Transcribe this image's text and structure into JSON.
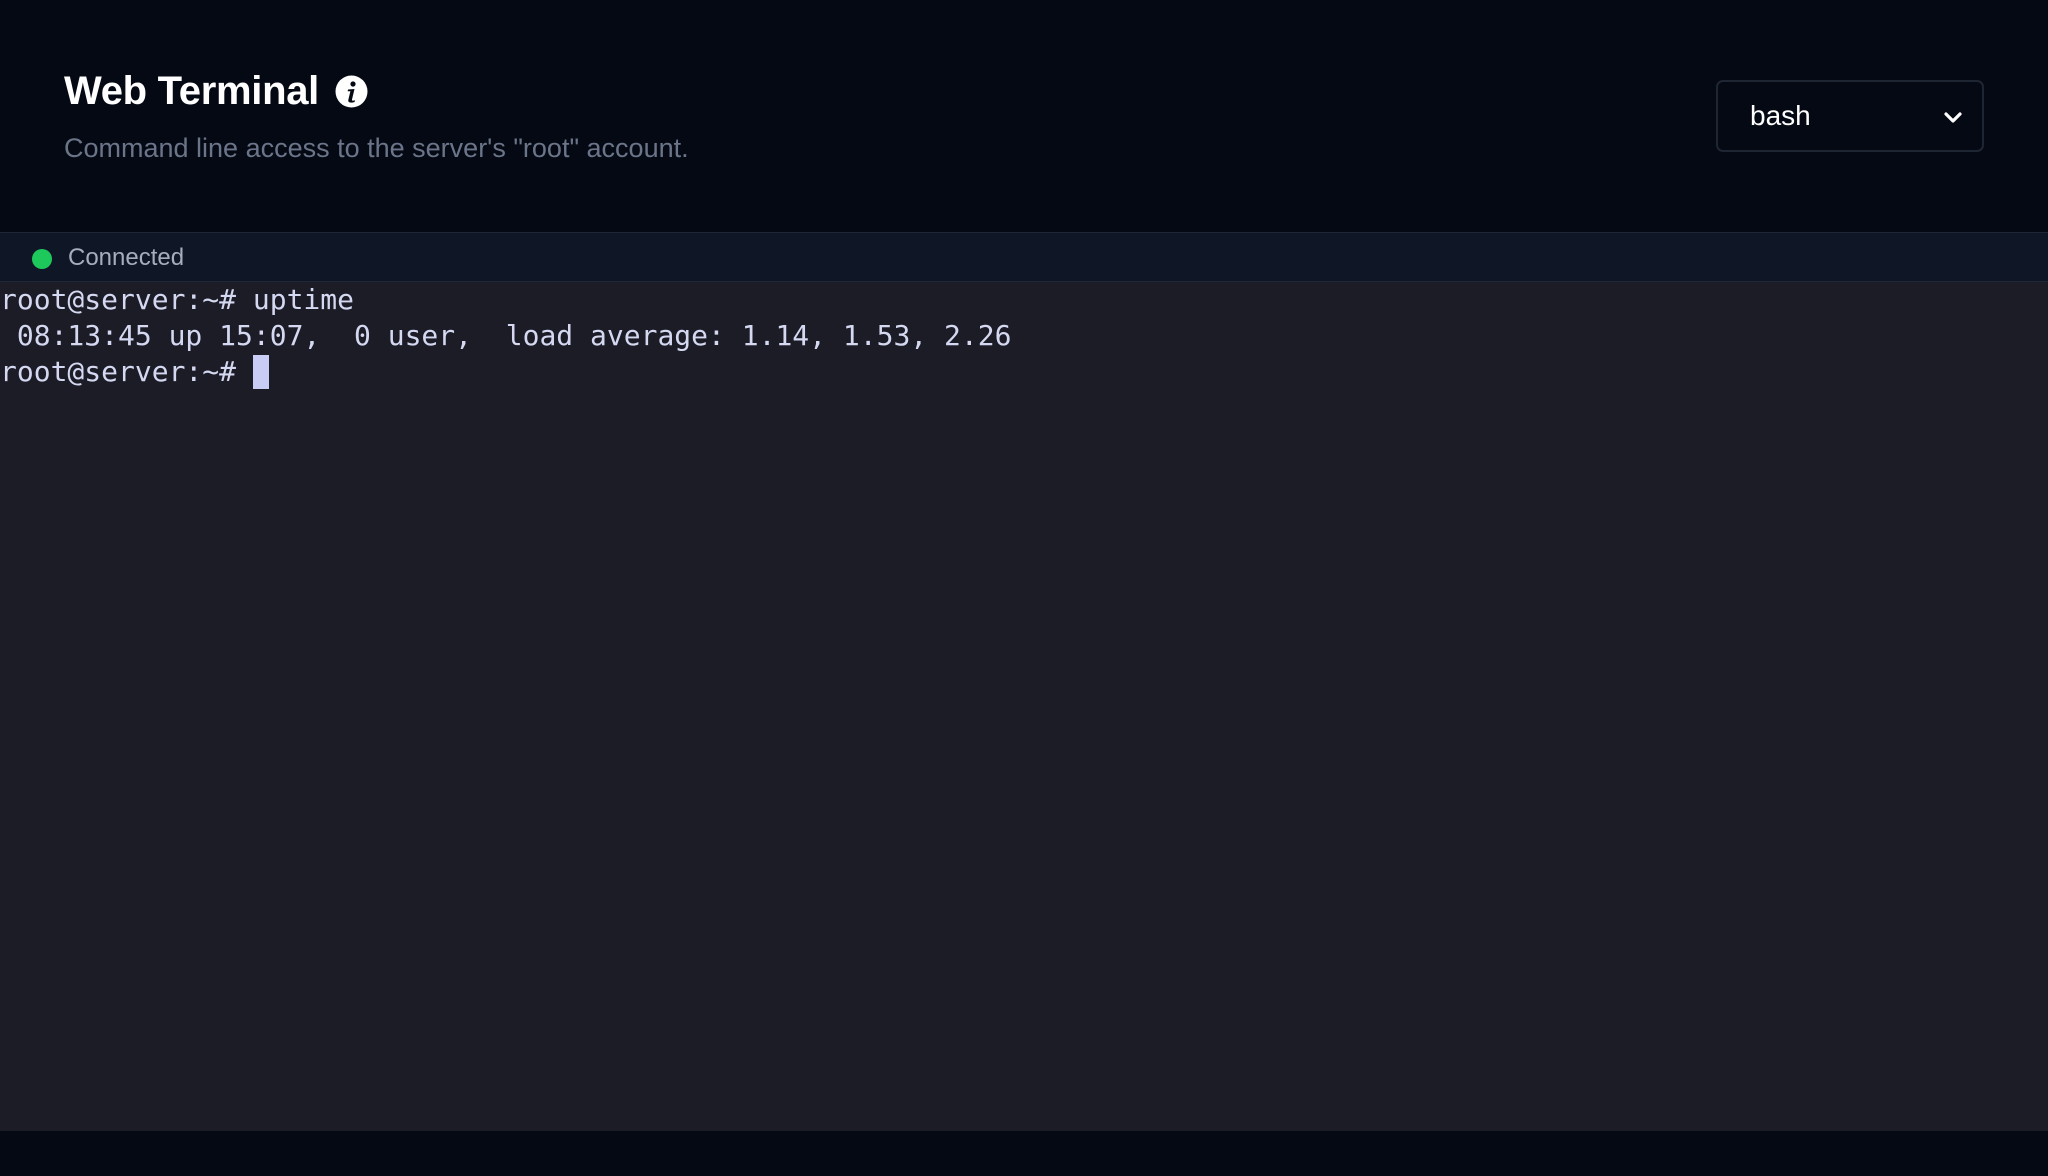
{
  "header": {
    "title": "Web Terminal",
    "subtitle": "Command line access to the server's \"root\" account.",
    "info_icon": "info-icon"
  },
  "shell_select": {
    "selected": "bash",
    "icon": "chevron-down-icon"
  },
  "status": {
    "text": "Connected",
    "color": "#1ec95c"
  },
  "terminal": {
    "lines": [
      "root@server:~# uptime",
      " 08:13:45 up 15:07,  0 user,  load average: 1.14, 1.53, 2.26",
      "root@server:~#"
    ]
  },
  "colors": {
    "background": "#050914",
    "terminal_bg": "#1c1c27",
    "terminal_text": "#d4d8f0",
    "subtitle": "#6b7589"
  }
}
